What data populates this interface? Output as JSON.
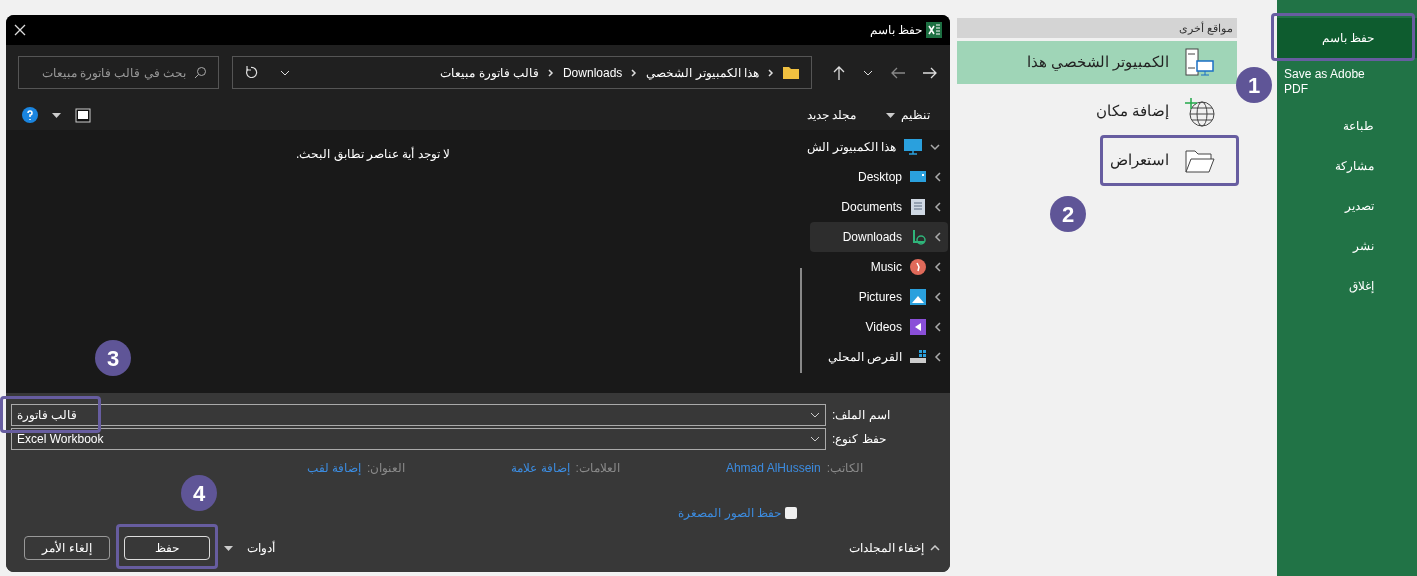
{
  "dialog": {
    "title": "حفظ باسم",
    "search": {
      "placeholder": "بحث في قالب فاتورة مبيعات"
    },
    "breadcrumb": [
      "هذا الكمبيوتر الشخصي",
      "Downloads",
      "قالب فاتورة مبيعات"
    ],
    "toolbar": {
      "organize": "تنظيم",
      "new_folder": "مجلد جديد"
    },
    "empty_message": "لا توجد أية عناصر تطابق البحث.",
    "tree": {
      "label": "هذا الكمبيوتر الش",
      "expanded": true,
      "children": [
        {
          "label": "Desktop",
          "kind": "desktop",
          "selected": false
        },
        {
          "label": "Documents",
          "kind": "documents",
          "selected": false
        },
        {
          "label": "Downloads",
          "kind": "downloads",
          "selected": true
        },
        {
          "label": "Music",
          "kind": "music",
          "selected": false
        },
        {
          "label": "Pictures",
          "kind": "pictures",
          "selected": false
        },
        {
          "label": "Videos",
          "kind": "videos",
          "selected": false
        },
        {
          "label": "القرص المحلي",
          "kind": "drive",
          "selected": false
        }
      ]
    },
    "file_name": {
      "label": "اسم الملف:",
      "value": "قالب فاتورة"
    },
    "file_type": {
      "label": "حفظ كنوع:",
      "value": "Excel Workbook"
    },
    "meta": [
      {
        "label": "الكاتب:",
        "value": "Ahmad AlHussein"
      },
      {
        "label": "العلامات:",
        "value": "إضافة علامة"
      },
      {
        "label": "العنوان:",
        "value": "إضافة لقب"
      }
    ],
    "thumbnails": {
      "label": "حفظ الصور المصغرة",
      "checked": false
    },
    "hide_folders": "إخفاء المجلدات",
    "tools": "أدوات",
    "save": "حفظ",
    "cancel": "إلغاء الأمر"
  },
  "backstage": {
    "heading": "مواقع أخرى",
    "locations": [
      {
        "label": "الكمبيوتر الشخصي هذا",
        "kind": "pc",
        "selected": true
      },
      {
        "label": "إضافة مكان",
        "kind": "add",
        "selected": false
      },
      {
        "label": "استعراض",
        "kind": "browse",
        "selected": false
      }
    ]
  },
  "sidebar": {
    "items": [
      {
        "label": "حفظ باسم",
        "selected": true
      },
      {
        "label": "Save as Adobe PDF",
        "selected": false
      },
      {
        "label": "طباعة",
        "selected": false
      },
      {
        "label": "مشاركة",
        "selected": false
      },
      {
        "label": "تصدير",
        "selected": false
      },
      {
        "label": "نشر",
        "selected": false
      },
      {
        "label": "إغلاق",
        "selected": false
      }
    ]
  },
  "callouts": [
    "1",
    "2",
    "3",
    "4"
  ]
}
